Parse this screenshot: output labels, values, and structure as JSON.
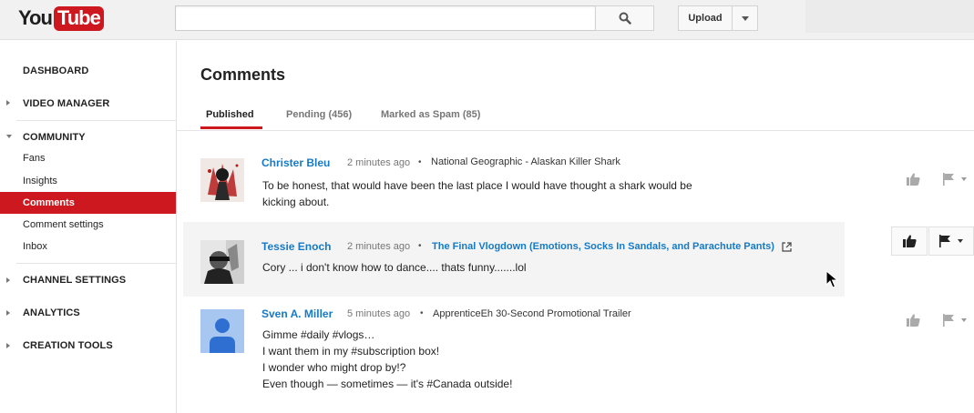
{
  "header": {
    "logo_you": "You",
    "logo_tube": "Tube",
    "search_value": "",
    "upload_label": "Upload"
  },
  "sidebar": {
    "dashboard": "DASHBOARD",
    "video_manager": "VIDEO MANAGER",
    "community": "COMMUNITY",
    "community_items": [
      "Fans",
      "Insights",
      "Comments",
      "Comment settings",
      "Inbox"
    ],
    "active_item": "Comments",
    "channel_settings": "CHANNEL SETTINGS",
    "analytics": "ANALYTICS",
    "creation_tools": "CREATION TOOLS"
  },
  "main": {
    "title": "Comments",
    "tabs": [
      {
        "label": "Published"
      },
      {
        "label": "Pending (456)"
      },
      {
        "label": "Marked as Spam (85)"
      }
    ],
    "comments": [
      {
        "author": "Christer Bleu",
        "time": "2 minutes ago",
        "separator": "•",
        "video": "National Geographic - Alaskan Killer Shark",
        "lines": [
          "To be honest, that would have been the last place I would have thought a shark would be",
          "kicking about."
        ]
      },
      {
        "author": "Tessie Enoch",
        "time": "2 minutes ago",
        "separator": "•",
        "video": "The Final Vlogdown (Emotions, Socks In Sandals, and Parachute Pants)",
        "lines": [
          "Cory ... i don't know how to dance.... thats funny.......lol"
        ]
      },
      {
        "author": "Sven A. Miller",
        "time": "5 minutes ago",
        "separator": "•",
        "video": "ApprenticeEh 30-Second Promotional Trailer",
        "lines": [
          "Gimme #daily #vlogs…",
          "I want them in my #subscription box!",
          "I wonder who might drop by!?",
          "Even though — sometimes — it's #Canada outside!"
        ]
      }
    ]
  },
  "colors": {
    "brand_red": "#cc181e",
    "link_blue": "#167ac6",
    "hover_row": "#f4f4f4"
  }
}
